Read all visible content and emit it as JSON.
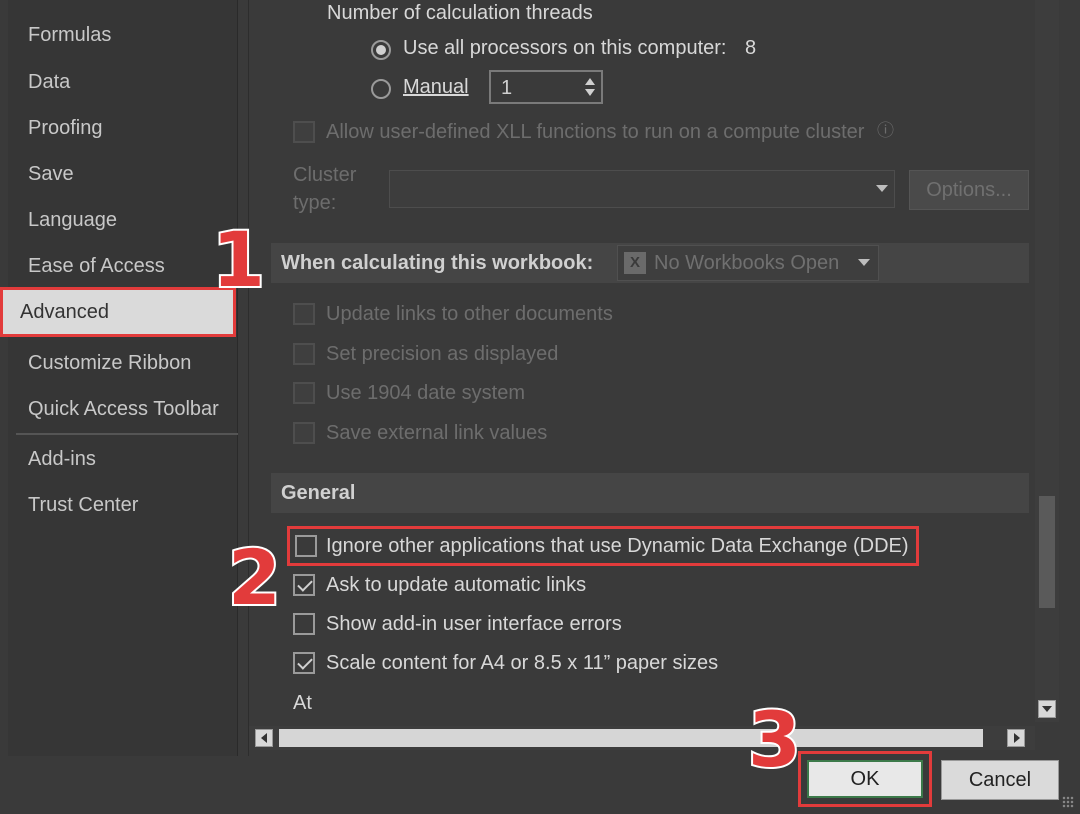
{
  "nav": {
    "items": [
      "Formulas",
      "Data",
      "Proofing",
      "Save",
      "Language",
      "Ease of Access",
      "Advanced",
      "Customize Ribbon",
      "Quick Access Toolbar",
      "Add-ins",
      "Trust Center"
    ]
  },
  "formulas": {
    "threads_label": "Number of calculation threads",
    "use_all_label": "Use all processors on this computer:",
    "processor_count": "8",
    "manual_label": "Manual",
    "manual_value": "1",
    "xll_label": "Allow user-defined XLL functions to run on a compute cluster",
    "cluster_label_1": "Cluster",
    "cluster_label_2": "type:",
    "options_button": "Options..."
  },
  "workbook_section": {
    "title": "When calculating this workbook:",
    "dropdown_value": "No Workbooks Open",
    "icon_letter": "X",
    "options": [
      "Update links to other documents",
      "Set precision as displayed",
      "Use 1904 date system",
      "Save external link values"
    ]
  },
  "general_section": {
    "title": "General",
    "options": [
      {
        "label": "Ignore other applications that use Dynamic Data Exchange (DDE)",
        "checked": false
      },
      {
        "label": "Ask to update automatic links",
        "checked": true
      },
      {
        "label": "Show add-in user interface errors",
        "checked": false
      },
      {
        "label": "Scale content for A4 or 8.5 x 11” paper sizes",
        "checked": true
      }
    ],
    "partial_label": "At"
  },
  "buttons": {
    "ok": "OK",
    "cancel": "Cancel"
  },
  "steps": [
    "1",
    "2",
    "3"
  ],
  "colors": {
    "annotation_red": "#e23b3b",
    "background": "#3a3a3a",
    "ok_border": "#3c7a4a"
  }
}
